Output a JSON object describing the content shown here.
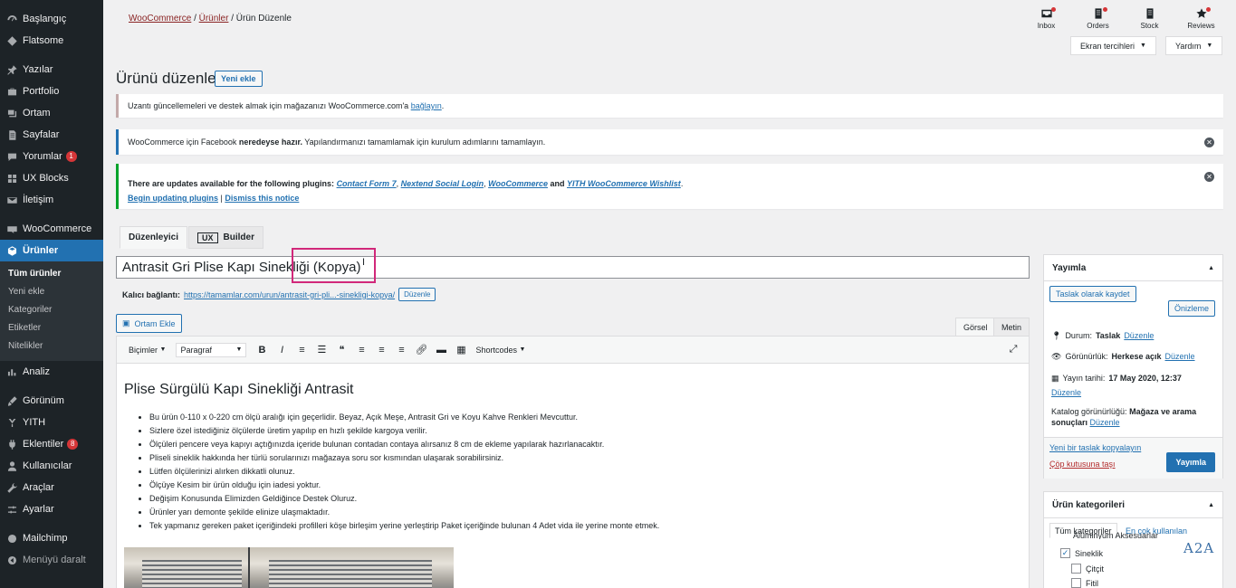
{
  "sidebar": {
    "items": [
      {
        "label": "Başlangıç",
        "icon": "dashboard-icon"
      },
      {
        "label": "Flatsome",
        "icon": "flatsome-icon"
      },
      {
        "label": "Yazılar",
        "icon": "pin-icon"
      },
      {
        "label": "Portfolio",
        "icon": "portfolio-icon"
      },
      {
        "label": "Ortam",
        "icon": "media-icon"
      },
      {
        "label": "Sayfalar",
        "icon": "pages-icon"
      },
      {
        "label": "Yorumlar",
        "icon": "comments-icon",
        "badge": "1"
      },
      {
        "label": "UX Blocks",
        "icon": "blocks-icon"
      },
      {
        "label": "İletişim",
        "icon": "mail-icon"
      },
      {
        "label": "WooCommerce",
        "icon": "woocommerce-icon"
      },
      {
        "label": "Ürünler",
        "icon": "products-icon"
      },
      {
        "label": "Analiz",
        "icon": "analytics-icon"
      },
      {
        "label": "Görünüm",
        "icon": "appearance-icon"
      },
      {
        "label": "YITH",
        "icon": "yith-icon"
      },
      {
        "label": "Eklentiler",
        "icon": "plugins-icon",
        "badge": "8"
      },
      {
        "label": "Kullanıcılar",
        "icon": "users-icon"
      },
      {
        "label": "Araçlar",
        "icon": "tools-icon"
      },
      {
        "label": "Ayarlar",
        "icon": "settings-icon"
      },
      {
        "label": "Mailchimp",
        "icon": "mailchimp-icon"
      },
      {
        "label": "Menüyü daralt",
        "icon": "collapse-icon"
      }
    ],
    "submenu": [
      "Tüm ürünler",
      "Yeni ekle",
      "Kategoriler",
      "Etiketler",
      "Nitelikler"
    ]
  },
  "breadcrumb": {
    "woo": "WooCommerce",
    "products": "Ürünler",
    "current": "Ürün Düzenle",
    "sep": "/"
  },
  "top_icons": [
    {
      "label": "Inbox",
      "icon": "inbox-icon"
    },
    {
      "label": "Orders",
      "icon": "orders-icon"
    },
    {
      "label": "Stock",
      "icon": "stock-icon"
    },
    {
      "label": "Reviews",
      "icon": "star-icon"
    }
  ],
  "screen_options": "Ekran tercihleri",
  "help": "Yardım",
  "page_title": "Ürünü düzenle",
  "add_new": "Yeni ekle",
  "notices": {
    "connect_pre": "Uzantı güncellemeleri ve destek almak için mağazanızı WooCommerce.com'a",
    "connect_link": "bağlayın",
    "facebook_pre": "WooCommerce için Facebook",
    "facebook_bold": "neredeyse hazır.",
    "facebook_post": "Yapılandırmanızı tamamlamak için kurulum adımlarını tamamlayın.",
    "updates_pre": "There are updates available for the following plugins:",
    "plugin1": "Contact Form 7",
    "plugin2": "Nextend Social Login",
    "plugin3": "WooCommerce",
    "and": "and",
    "plugin4": "YITH WooCommerce Wishlist",
    "begin": "Begin updating plugins",
    "dismiss": "Dismiss this notice"
  },
  "editor_tabs": {
    "editor": "Düzenleyici",
    "ux": "UX",
    "builder": "Builder"
  },
  "title_value": "Antrasit Gri Plise Kapı Sinekliği (Kopya)",
  "permalink": {
    "label": "Kalıcı bağlantı:",
    "url": "https://tamamlar.com/urun/antrasit-gri-pli...-sinekligi-kopya/",
    "edit": "Düzenle"
  },
  "media_button": "Ortam Ekle",
  "modes": {
    "visual": "Görsel",
    "text": "Metin"
  },
  "toolbar": {
    "formats": "Biçimler",
    "paragraph": "Paragraf",
    "shortcodes": "Shortcodes"
  },
  "content": {
    "heading": "Plise Sürgülü Kapı Sinekliği Antrasit",
    "bullets": [
      "Bu ürün 0-110 x 0-220 cm ölçü aralığı için geçerlidir. Beyaz, Açık Meşe, Antrasit Gri ve Koyu Kahve Renkleri Mevcuttur.",
      "Sizlere özel istediğiniz ölçülerde üretim yapılıp en hızlı şekilde kargoya verilir.",
      "Ölçüleri pencere veya kapıyı açtığınızda içeride bulunan contadan contaya alırsanız 8 cm de ekleme yapılarak hazırlanacaktır.",
      "Pliseli sineklik hakkında her türlü sorularınızı mağazaya soru sor kısmından ulaşarak sorabilirsiniz.",
      "Lütfen ölçülerinizi alırken dikkatli olunuz.",
      "Ölçüye Kesim bir ürün olduğu için iadesi yoktur.",
      "Değişim Konusunda Elimizden Geldiğince Destek Oluruz.",
      "Ürünler yarı demonte şekilde elinize ulaşmaktadır.",
      "Tek yapmanız gereken paket içeriğindeki profilleri köşe birleşim yerine yerleştirip Paket içeriğinde bulunan 4 Adet vida ile yerine monte etmek."
    ]
  },
  "publish": {
    "title": "Yayımla",
    "save_draft": "Taslak olarak kaydet",
    "preview": "Önizleme",
    "status_label": "Durum:",
    "status_value": "Taslak",
    "visibility_label": "Görünürlük:",
    "visibility_value": "Herkese açık",
    "date_label": "Yayın tarihi:",
    "date_value": "17 May 2020, 12:37",
    "catalog_label": "Katalog görünürlüğü:",
    "catalog_value": "Mağaza ve arama sonuçları",
    "edit": "Düzenle",
    "copy_draft": "Yeni bir taslak kopyalayın",
    "trash": "Çöp kutusuna taşı",
    "publish": "Yayımla"
  },
  "categories": {
    "title": "Ürün kategorileri",
    "tab_all": "Tüm kategoriler",
    "tab_used": "En çok kullanılan",
    "partial": "Alüminyum Aksesuarlar",
    "items": [
      {
        "label": "Sineklik",
        "checked": true
      },
      {
        "label": "Çitçit",
        "checked": false
      },
      {
        "label": "Fitil",
        "checked": false
      }
    ]
  },
  "watermark": "A2A"
}
